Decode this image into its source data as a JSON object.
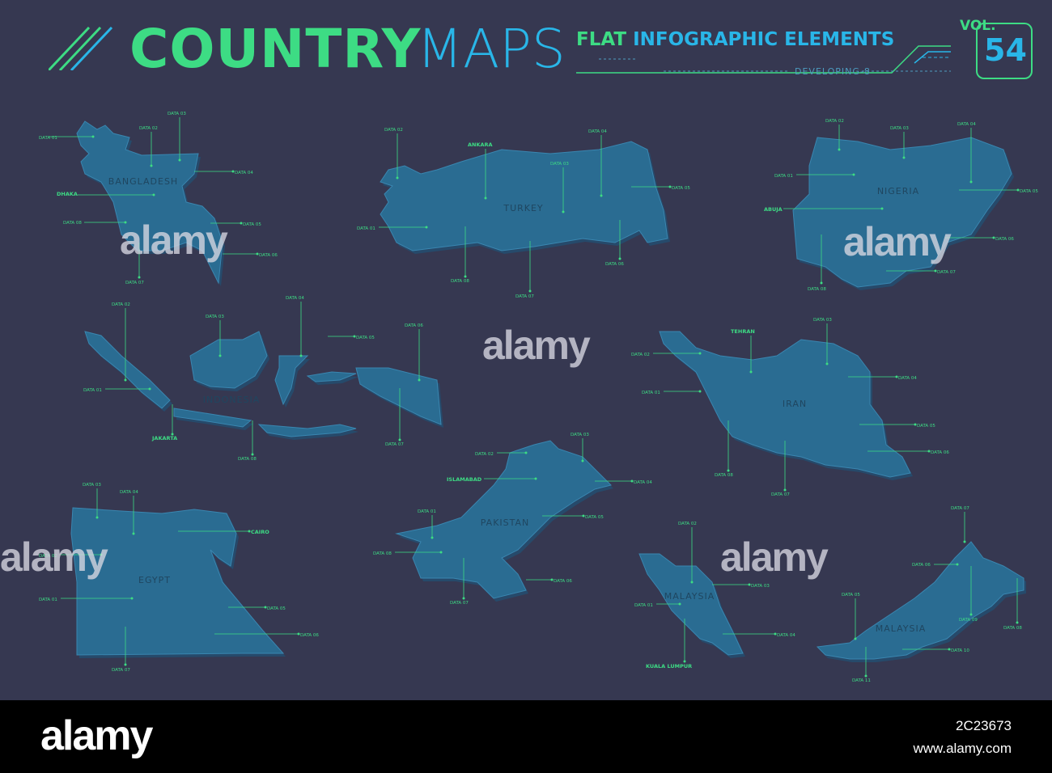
{
  "header": {
    "title_main": "COUNTRY",
    "title_sub": "MAPS",
    "subtitle_a": "FLAT",
    "subtitle_b": "INFOGRAPHIC ELEMENTS",
    "developer": "DEVELOPING-8",
    "vol_label": "VOL.",
    "vol_number": "54"
  },
  "colors": {
    "background": "#363851",
    "map_fill": "#2a6c92",
    "accent_green": "#3ddc84",
    "accent_blue": "#29b6e8"
  },
  "maps": [
    {
      "name": "BANGLADESH",
      "labels": [
        "DATA 01",
        "DATA 02",
        "DATA 03",
        "DATA 04",
        "DHAKA",
        "DATA 08",
        "DATA 05",
        "DATA 06",
        "DATA 07"
      ]
    },
    {
      "name": "TURKEY",
      "labels": [
        "DATA 02",
        "ANKARA",
        "DATA 03",
        "DATA 04",
        "DATA 05",
        "DATA 01",
        "DATA 08",
        "DATA 07",
        "DATA 06"
      ]
    },
    {
      "name": "NIGERIA",
      "labels": [
        "DATA 02",
        "DATA 03",
        "DATA 04",
        "DATA 01",
        "DATA 05",
        "ABUJA",
        "DATA 06",
        "DATA 07",
        "DATA 08"
      ]
    },
    {
      "name": "INDONESIA",
      "labels": [
        "DATA 02",
        "DATA 03",
        "DATA 04",
        "DATA 05",
        "DATA 06",
        "DATA 01",
        "JAKARTA",
        "DATA 08",
        "DATA 07"
      ]
    },
    {
      "name": "IRAN",
      "labels": [
        "DATA 02",
        "TEHRAN",
        "DATA 03",
        "DATA 04",
        "DATA 01",
        "DATA 05",
        "DATA 06",
        "DATA 08",
        "DATA 07"
      ]
    },
    {
      "name": "PAKISTAN",
      "labels": [
        "DATA 03",
        "DATA 02",
        "ISLAMABAD",
        "DATA 04",
        "DATA 01",
        "DATA 05",
        "DATA 08",
        "DATA 06",
        "DATA 07"
      ]
    },
    {
      "name": "EGYPT",
      "labels": [
        "DATA 03",
        "DATA 04",
        "CAIRO",
        "DATA 02",
        "DATA 01",
        "DATA 05",
        "DATA 06",
        "DATA 07"
      ]
    },
    {
      "name": "MALAYSIA",
      "labels": [
        "DATA 02",
        "DATA 03",
        "DATA 01",
        "DATA 04",
        "KUALA LUMPUR"
      ]
    },
    {
      "name": "MALAYSIA",
      "labels": [
        "DATA 07",
        "DATA 06",
        "DATA 05",
        "DATA 09",
        "DATA 08",
        "DATA 10",
        "DATA 11"
      ]
    }
  ],
  "watermark": "alamy",
  "footer": {
    "logo": "alamy",
    "image_id": "2C23673",
    "url": "www.alamy.com"
  }
}
